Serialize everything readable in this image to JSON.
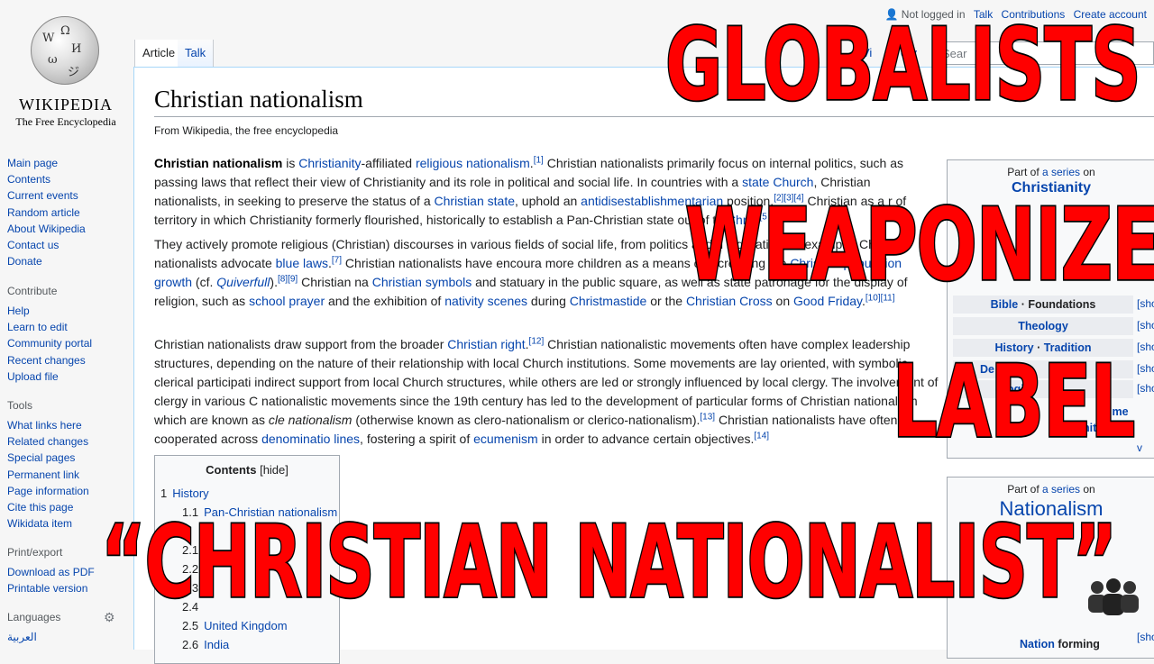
{
  "logo": {
    "wordmark": "WIKIPEDIA",
    "tagline": "The Free Encyclopedia"
  },
  "sidebar": {
    "navigation": [
      "Main page",
      "Contents",
      "Current events",
      "Random article",
      "About Wikipedia",
      "Contact us",
      "Donate"
    ],
    "contribute": {
      "heading": "Contribute",
      "items": [
        "Help",
        "Learn to edit",
        "Community portal",
        "Recent changes",
        "Upload file"
      ]
    },
    "tools": {
      "heading": "Tools",
      "items": [
        "What links here",
        "Related changes",
        "Special pages",
        "Permanent link",
        "Page information",
        "Cite this page",
        "Wikidata item"
      ]
    },
    "print": {
      "heading": "Print/export",
      "items": [
        "Download as PDF",
        "Printable version"
      ]
    },
    "languages": {
      "heading": "Languages",
      "items": [
        "العربية"
      ]
    }
  },
  "personal": {
    "not_logged_in": "Not logged in",
    "talk": "Talk",
    "contributions": "Contributions",
    "create_account": "Create account"
  },
  "tabs": {
    "article": "Article",
    "talk": "Talk",
    "view_partial": "Vi",
    "history_partial": "ory"
  },
  "search": {
    "placeholder": "Sear"
  },
  "page": {
    "title": "Christian nationalism",
    "tagline": "From Wikipedia, the free encyclopedia"
  },
  "paragraphs": {
    "p1": {
      "bold": "Christian nationalism",
      "t1": " is ",
      "l1": "Christianity",
      "t2": "-affiliated ",
      "l2": "religious nationalism",
      "s1": "[1]",
      "t3": " Christian nationalists primarily focus on internal politics, such as passing laws that reflect their view of Christianity and its role in political and social life. In countries with a ",
      "l3": "state Church",
      "t4": ", Christian nationalists, in seeking to preserve the status of a ",
      "l4": "Christian state",
      "t5": ", uphold an ",
      "l5": "antidisestablishmentarian",
      "t6": " position.",
      "s2": "[2][3][4]",
      "t7": " Christian",
      "t8": " as a r",
      "t9": " of territory in which Christianity formerly flourished, historically to establish a Pan-Christian state out of th",
      "l6": "Christ",
      "s3": "[5"
    },
    "p2": {
      "t1": "They actively promote religious (Christian) discourses in various fields of social life, from politics and h",
      "t2": " legislation for example, Christian nationalists advocate ",
      "l1": "blue laws",
      "s1": "[7]",
      "t3": " Christian nationalists have encoura",
      "t4": " more children as a means of increasing the ",
      "l2": "Christian population growth",
      "t5": " (cf. ",
      "l3": "Quiverfull",
      "t6": ").",
      "s2": "[8][9]",
      "t7": " Christian na",
      "l4": "Christian",
      "l5": "symbols",
      "t8": " and statuary in the public square, as well as state patronage for the display of religion, such as ",
      "l6": "school prayer",
      "t9": " and the exhibition of ",
      "l7": "nativity scenes",
      "t10": " during ",
      "l8": "Christmastide",
      "t11": " or the ",
      "l9": "Christian Cross",
      "t12": " on ",
      "l10": "Good Friday",
      "s3": "[10][11]"
    },
    "p3": {
      "t1": "Christian nationalists draw support from the broader ",
      "l1": "Christian right",
      "s1": "[12]",
      "t2": " Christian nationalistic movements often have complex leadership structures, depending on the nature of their relationship with local Church institutions. Some movements are lay oriented, with symbolic clerical participati",
      "t3": " indirect support from local Church structures, while others are led or strongly influenced by local clergy. The involvement of clergy in various C",
      "t4": " nationalistic movements since the 19th century has led to the development of particular forms of Christian nationalism which are known as ",
      "i1": "cle",
      "i2": "nationalism",
      "t5": " (otherwise known as clero-nationalism or clerico-nationalism).",
      "s2": "[13]",
      "t6": " Christian nationalists have often cooperated across ",
      "l2": "denominatio",
      "l3": "lines",
      "t7": ", fostering a spirit of ",
      "l4": "ecumenism",
      "t8": " in order to advance certain objectives.",
      "s3": "[14]"
    }
  },
  "toc": {
    "title": "Contents",
    "hide": "[hide]",
    "items": [
      {
        "num": "1",
        "label": "History"
      },
      {
        "num": "1.1",
        "label": "Pan-Christian nationalism"
      },
      {
        "num": "2",
        "label": ""
      },
      {
        "num": "2.1",
        "label": ""
      },
      {
        "num": "2.2",
        "label": ""
      },
      {
        "num": "2.3",
        "label": ""
      },
      {
        "num": "2.4",
        "label": ""
      },
      {
        "num": "2.5",
        "label": "United Kingdom"
      },
      {
        "num": "2.6",
        "label": "India"
      }
    ]
  },
  "infobox_christianity": {
    "part_of": "Part of ",
    "series_link": "a series",
    "on": " on",
    "name": "Christianity",
    "rows": [
      {
        "a": "Bible",
        "sep": " · ",
        "b": "Foundations"
      },
      {
        "a": "Theology",
        "sep": "",
        "b": ""
      },
      {
        "a": "History",
        "sep": " · ",
        "b": "Tradition"
      },
      {
        "a": "De",
        "sep": "",
        "b": ""
      },
      {
        "a": "",
        "sep": "",
        "b": "ogics"
      }
    ],
    "partial_c": "C",
    "partial_me": "me",
    "partial_nity": "nity p",
    "partial_v": "v",
    "show": "[sho"
  },
  "infobox_nationalism": {
    "part_of": "Part of ",
    "series_link": "a series",
    "on": " on",
    "name": "Nationalism",
    "bottom_link": "Nation",
    "bottom_text": " forming",
    "show": "[sho"
  },
  "overlay": {
    "line1": "GLOBALISTS",
    "line2": "WEAPONIZE",
    "line3": "LABEL",
    "line4": "“CHRISTIAN NATIONALIST”"
  },
  "colors": {
    "link": "#0645ad",
    "overlay_fill": "#ff0000",
    "overlay_stroke": "#000000",
    "sidebar_bg": "#f6f6f6"
  }
}
